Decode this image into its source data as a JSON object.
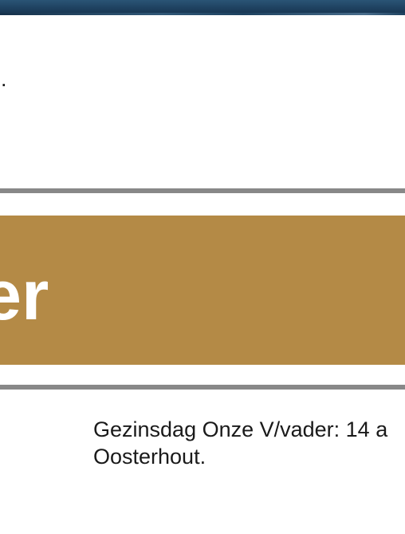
{
  "slide": {
    "intro_fragment": "n.",
    "title_fragment": "er",
    "body_line_1": "Gezinsdag Onze V/vader: 14 a",
    "body_line_2": "Oosterhout."
  },
  "colors": {
    "banner": "#1f4665",
    "title_bar": "#b48a46",
    "rule": "#888888",
    "title_text": "#ffffff",
    "body_text": "#1a1a1a"
  }
}
